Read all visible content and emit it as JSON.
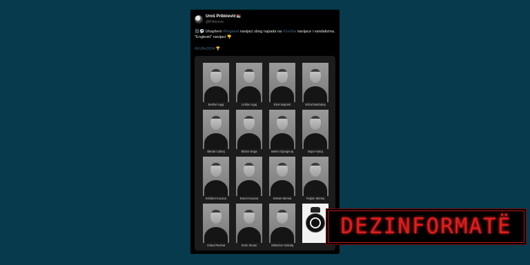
{
  "tweet": {
    "display_name": "Uroš Pribićević",
    "flag": "🇷🇸",
    "handle": "@Pribicevic",
    "text": {
      "emoji": "⛓️⚽",
      "p1": "Uhapšeni",
      "hashtag1": "#England",
      "p2": "navijaci zbog napada na",
      "hashtag2": "#Serbia",
      "p3": "navijace i vandalizma. \"Engleski\" navijaci",
      "emoji_end": "👎"
    },
    "hashtag_line": "#EURo2024",
    "hashtag_emoji": "🏆"
  },
  "mugshots": [
    {
      "name": "Besfort Agaj"
    },
    {
      "name": "Lirldon Agaj"
    },
    {
      "name": "Elvin Bajrami"
    },
    {
      "name": "Erlind Bashukaj"
    },
    {
      "name": "Bledar Cakraj"
    },
    {
      "name": "Elidon Dega"
    },
    {
      "name": "Bekim Gjongecaj"
    },
    {
      "name": "Bujar Hykaj"
    },
    {
      "name": "Emiliant Kucana"
    },
    {
      "name": "Erami Kucana"
    },
    {
      "name": "Kismet Memia"
    },
    {
      "name": "Fatjom Memia"
    },
    {
      "name": "Arland Rexhat"
    },
    {
      "name": "Ervin Sinani"
    },
    {
      "name": "Shkelzen Sokolaj"
    },
    {
      "name": ""
    }
  ],
  "stamp": {
    "label": "DEZINFORMATË",
    "color": "#e31b1b"
  }
}
